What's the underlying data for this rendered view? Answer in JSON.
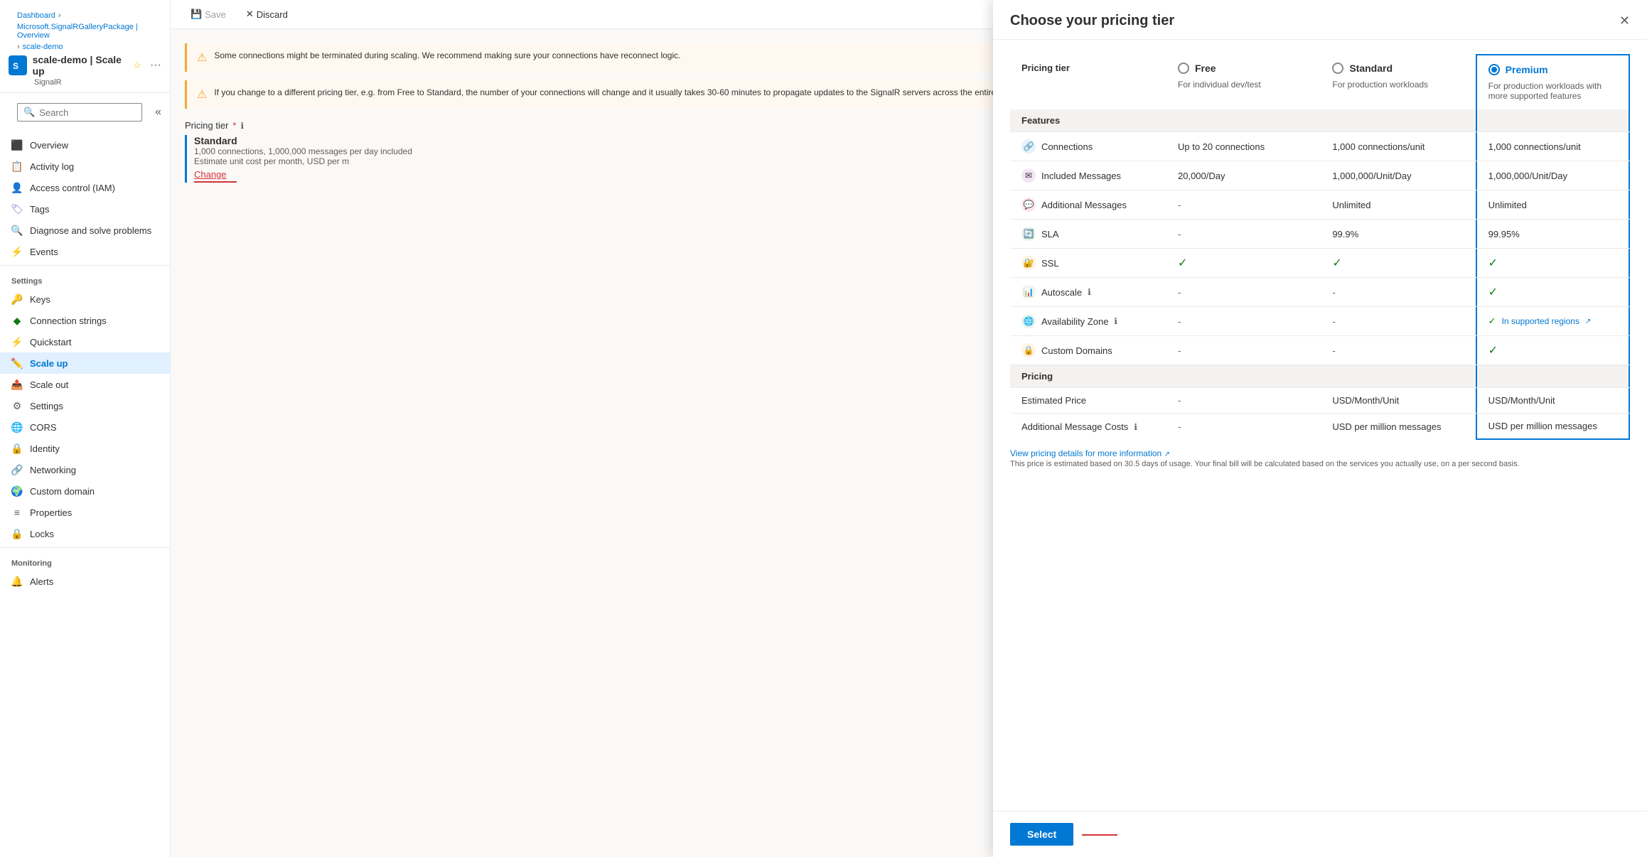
{
  "breadcrumb": {
    "items": [
      "Dashboard",
      "Microsoft.SignalRGalleryPackage | Overview",
      "scale-demo"
    ]
  },
  "app": {
    "title": "scale-demo | Scale up",
    "subtitle": "SignalR",
    "favorite_label": "☆",
    "more_label": "···"
  },
  "search": {
    "placeholder": "Search"
  },
  "sidebar_collapse": "«",
  "toolbar": {
    "save_label": "Save",
    "discard_label": "Discard"
  },
  "nav": {
    "items": [
      {
        "label": "Overview",
        "icon": "⬤",
        "group": null
      },
      {
        "label": "Activity log",
        "icon": "📋",
        "group": null
      },
      {
        "label": "Access control (IAM)",
        "icon": "👤",
        "group": null
      },
      {
        "label": "Tags",
        "icon": "🏷",
        "group": null
      },
      {
        "label": "Diagnose and solve problems",
        "icon": "🔍",
        "group": null
      },
      {
        "label": "Events",
        "icon": "⚡",
        "group": null
      }
    ],
    "settings_label": "Settings",
    "settings_items": [
      {
        "label": "Keys",
        "icon": "🔑"
      },
      {
        "label": "Connection strings",
        "icon": "◆"
      },
      {
        "label": "Quickstart",
        "icon": "🚀"
      },
      {
        "label": "Scale up",
        "icon": "✏️",
        "active": true
      },
      {
        "label": "Scale out",
        "icon": "📤"
      },
      {
        "label": "Settings",
        "icon": "⚙"
      },
      {
        "label": "CORS",
        "icon": "🌐"
      },
      {
        "label": "Identity",
        "icon": "🔒"
      },
      {
        "label": "Networking",
        "icon": "🔗"
      },
      {
        "label": "Custom domain",
        "icon": "🌍"
      },
      {
        "label": "Properties",
        "icon": "≡"
      },
      {
        "label": "Locks",
        "icon": "🔒"
      }
    ],
    "monitoring_label": "Monitoring",
    "monitoring_items": [
      {
        "label": "Alerts",
        "icon": "🔔"
      }
    ]
  },
  "warnings": [
    {
      "text": "Some connections might be terminated during scaling. We recommend making sure your connections have reconnect logic."
    },
    {
      "text": "If you change to a different pricing tier, e.g. from Free to Standard, the number of your connections will change and it usually takes 30-60 minutes to propagate updates to the SignalR servers across the entire Internet. Your service might be temporarily unavailable until the update is updated. Generally, it's not recommended to change your pricing tier."
    }
  ],
  "pricing_tier_section": {
    "label": "Pricing tier",
    "required": true,
    "current_tier": "Standard",
    "current_desc": "1,000 connections, 1,000,000 messages per day included",
    "estimate_label": "Estimate unit cost",
    "per_month_label": "per month,",
    "usd_per_m": "USD per m",
    "change_label": "Change"
  },
  "panel": {
    "title": "Choose your pricing tier",
    "close_label": "✕",
    "tiers": [
      {
        "name": "Free",
        "radio_selected": false,
        "desc": "For individual dev/test"
      },
      {
        "name": "Standard",
        "radio_selected": false,
        "desc": "For production workloads"
      },
      {
        "name": "Premium",
        "radio_selected": true,
        "desc": "For production workloads with more supported features"
      }
    ],
    "features_label": "Features",
    "features": [
      {
        "name": "Connections",
        "icon_type": "connections",
        "free": "Up to 20 connections",
        "standard": "1,000 connections/unit",
        "premium": "1,000 connections/unit"
      },
      {
        "name": "Included Messages",
        "icon_type": "messages",
        "free": "20,000/Day",
        "standard": "1,000,000/Unit/Day",
        "premium": "1,000,000/Unit/Day"
      },
      {
        "name": "Additional Messages",
        "icon_type": "additional",
        "free": "-",
        "standard": "Unlimited",
        "premium": "Unlimited"
      },
      {
        "name": "SLA",
        "icon_type": "sla",
        "free": "-",
        "standard": "99.9%",
        "premium": "99.95%"
      },
      {
        "name": "SSL",
        "icon_type": "ssl",
        "free": "check",
        "standard": "check",
        "premium": "check"
      },
      {
        "name": "Autoscale",
        "icon_type": "autoscale",
        "free": "-",
        "standard": "-",
        "premium": "check"
      },
      {
        "name": "Availability Zone",
        "icon_type": "avail",
        "free": "-",
        "standard": "-",
        "premium": "In supported regions"
      },
      {
        "name": "Custom Domains",
        "icon_type": "domains",
        "free": "-",
        "standard": "-",
        "premium": "check"
      }
    ],
    "pricing_label": "Pricing",
    "pricing_rows": [
      {
        "name": "Estimated Price",
        "free": "-",
        "standard": "USD/Month/Unit",
        "premium": "USD/Month/Unit"
      },
      {
        "name": "Additional Message Costs",
        "has_info": true,
        "free": "-",
        "standard": "USD per million messages",
        "premium": "USD per million messages"
      }
    ],
    "pricing_link": "View pricing details for more information",
    "pricing_note": "This price is estimated based on 30.5 days of usage. Your final bill will be calculated based on the services you actually use, on a per second basis.",
    "select_label": "Select"
  }
}
